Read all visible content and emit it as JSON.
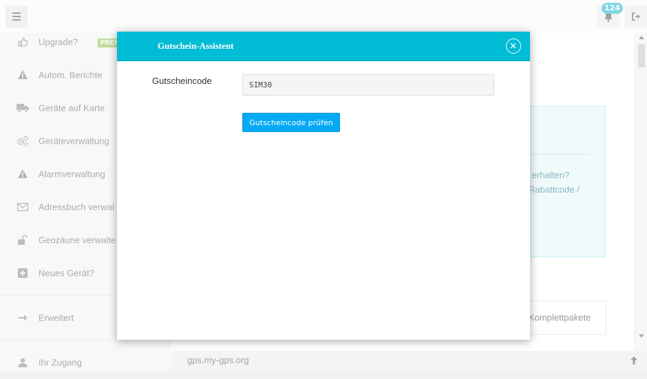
{
  "header": {
    "notifications_count": "124",
    "menu_icon": "hamburger-icon",
    "bell_icon": "bell-icon",
    "logout_icon": "logout-icon"
  },
  "sidebar": {
    "items": [
      {
        "label": "Upgrade?",
        "icon": "thumbs-up-icon",
        "badge": "PREM"
      },
      {
        "label": "Autom. Berichte",
        "icon": "warning-icon"
      },
      {
        "label": "Geräte auf Karte",
        "icon": "truck-icon"
      },
      {
        "label": "Geräteverwaltung",
        "icon": "gears-icon"
      },
      {
        "label": "Alarmverwaltung",
        "icon": "warning-icon"
      },
      {
        "label": "Adressbuch verwal",
        "icon": "envelope-icon"
      },
      {
        "label": "Geozäune verwalte",
        "icon": "unlock-icon"
      },
      {
        "label": "Neues Gerät?",
        "icon": "plus-square-icon"
      },
      {
        "label": "Erweitert",
        "icon": "arrow-right-icon"
      },
      {
        "label": "Ihr Zugang",
        "icon": "user-icon"
      }
    ]
  },
  "content": {
    "info_text_1": "erhalten?",
    "info_text_2": "Rabattcode /",
    "tab_text": "Komplettpakete"
  },
  "footer": {
    "url": "gps.my-gps.org"
  },
  "modal": {
    "title": "Gutschein-Assistent",
    "code_label": "Gutscheincode",
    "code_value": "SIM30",
    "check_button": "Gutscheincode prüfen"
  },
  "colors": {
    "accent": "#00bcd4",
    "button": "#03a9f4",
    "badge": "#1ab5d0",
    "premium": "#8bc34a"
  }
}
